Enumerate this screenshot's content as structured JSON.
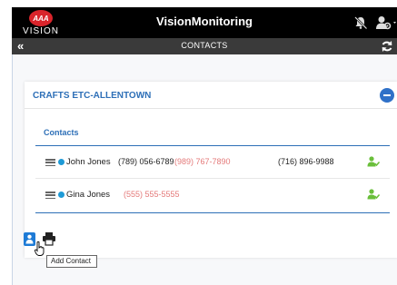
{
  "header": {
    "logo_text": "AAA",
    "logo_word": "VISION",
    "app_title": "VisionMonitoring"
  },
  "subheader": {
    "back_label": "«",
    "title": "CONTACTS"
  },
  "account": {
    "name": "CRAFTS ETC-ALLENTOWN"
  },
  "contacts": {
    "title": "Contacts",
    "rows": [
      {
        "name": "John Jones",
        "phone1": "(789) 056-6789",
        "phone2": "(989) 767-7890",
        "phone3": "(716) 896-9988"
      },
      {
        "name": "Gina Jones",
        "phone1": "(555) 555-5555"
      }
    ]
  },
  "actions": {
    "tooltip": "Add Contact"
  },
  "colors": {
    "accent": "#2d6fb7",
    "status_dot": "#1e9ad6",
    "alert_phone": "#e47a7a",
    "user_ok": "#6abf3b"
  },
  "icons": {
    "back": "double-chevron-left-icon",
    "refresh": "refresh-icon",
    "notifications_off": "bell-slash-icon",
    "user_menu": "user-gear-icon",
    "collapse": "minus-circle-icon",
    "drag": "hamburger-icon",
    "status": "status-dot-icon",
    "user_check": "user-check-icon",
    "add_contact": "add-contact-icon",
    "print": "printer-icon"
  }
}
